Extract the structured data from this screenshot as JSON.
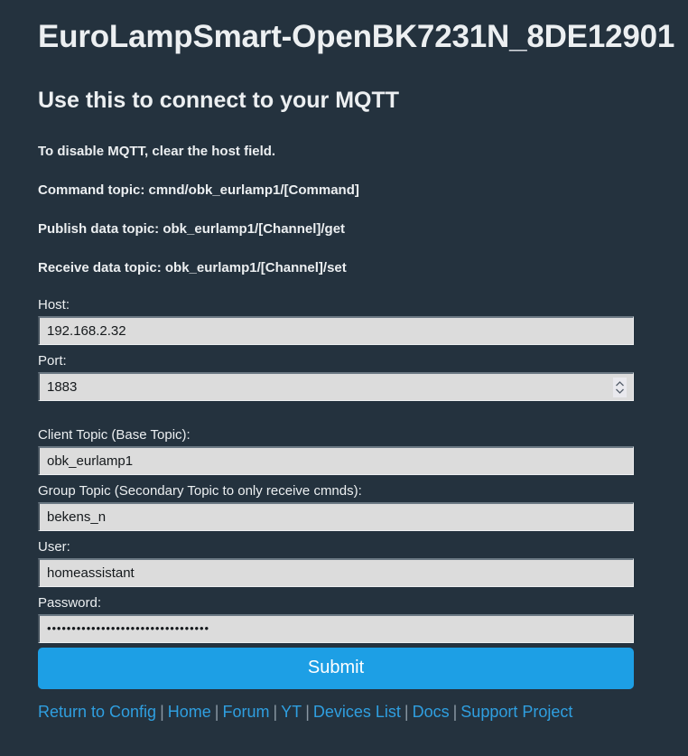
{
  "header": {
    "device_title": "EuroLampSmart-OpenBK7231N_8DE12901",
    "subtitle": "Use this to connect to your MQTT"
  },
  "notes": [
    "To disable MQTT, clear the host field.",
    "Command topic: cmnd/obk_eurlamp1/[Command]",
    "Publish data topic: obk_eurlamp1/[Channel]/get",
    "Receive data topic: obk_eurlamp1/[Channel]/set"
  ],
  "form": {
    "host": {
      "label": "Host:",
      "value": "192.168.2.32"
    },
    "port": {
      "label": "Port:",
      "value": "1883"
    },
    "client_topic": {
      "label": "Client Topic (Base Topic):",
      "value": "obk_eurlamp1"
    },
    "group_topic": {
      "label": "Group Topic (Secondary Topic to only receive cmnds):",
      "value": "bekens_n"
    },
    "user": {
      "label": "User:",
      "value": "homeassistant"
    },
    "password": {
      "label": "Password:",
      "value": "•••••••••••••••••••••••••••••••••"
    },
    "submit_label": "Submit"
  },
  "footer": {
    "separator": "|",
    "links": [
      "Return to Config",
      "Home",
      "Forum",
      "YT",
      "Devices List",
      "Docs",
      "Support Project"
    ]
  },
  "colors": {
    "background": "#24323e",
    "text": "#eceff1",
    "input_bg": "#dcdcdc",
    "submit_bg": "#1d9fe5",
    "link": "#2f9fe0"
  }
}
